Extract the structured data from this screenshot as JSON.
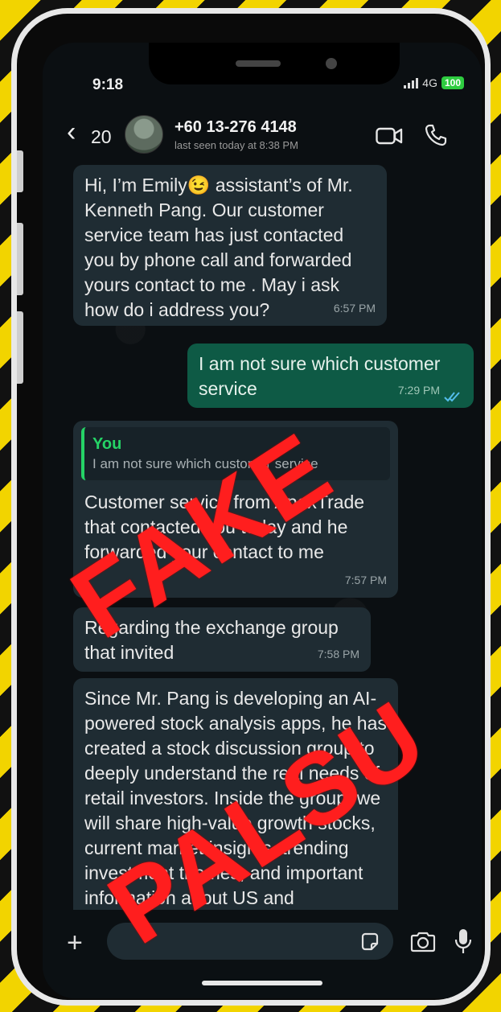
{
  "status_bar": {
    "time": "9:18",
    "network": "4G",
    "battery": "100"
  },
  "header": {
    "back_count": "20",
    "contact_name": "+60 13-276 4148",
    "last_seen": "last seen today at 8:38 PM"
  },
  "messages": [
    {
      "direction": "incoming",
      "text": "Hi, I’m Emily😉 assistant’s of Mr. Kenneth Pang. Our customer service team has just contacted you by phone call and forwarded yours contact to me  . May i ask how do i address you?",
      "time": "6:57 PM"
    },
    {
      "direction": "outgoing",
      "text": "I am not sure which customer service",
      "time": "7:29 PM",
      "status": "read"
    },
    {
      "direction": "incoming",
      "quote": {
        "author": "You",
        "text": "I am not sure which customer service"
      },
      "text": "Customer service from ApexTrade that contacted you today and he forwarded your contact to me",
      "time": "7:57 PM"
    },
    {
      "direction": "incoming",
      "text": "Regarding the exchange group that invited",
      "time": "7:58 PM"
    },
    {
      "direction": "incoming",
      "text": "Since Mr. Pang is developing an AI-powered stock analysis apps, he has created a stock discussion group to deeply understand the real needs of retail investors. Inside the group, we will share high-value growth stocks, current market insights, trending investment themes, and important information about US and"
    }
  ],
  "input": {
    "placeholder": ""
  },
  "overlay": {
    "stamp_top": "FAKE",
    "stamp_bottom": "PALSU"
  },
  "colors": {
    "incoming_bubble": "#1f2c33",
    "outgoing_bubble": "#0e5a45",
    "accent": "#25d366",
    "stamp": "#ff1e1e",
    "frame_stripes": "#f2d400"
  },
  "icons": [
    "back-chevron-icon",
    "video-call-icon",
    "phone-icon",
    "plus-icon",
    "sticker-icon",
    "camera-icon",
    "mic-icon",
    "read-ticks-icon",
    "signal-icon"
  ]
}
